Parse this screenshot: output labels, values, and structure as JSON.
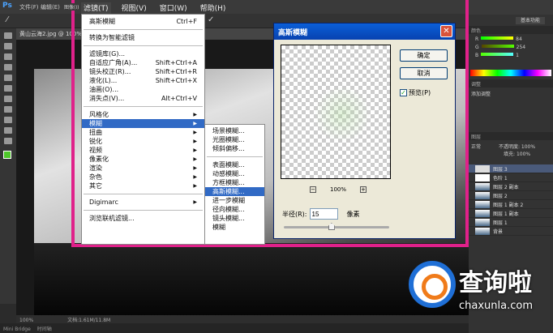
{
  "app": {
    "logo": "Ps",
    "menus": [
      "文件(F)",
      "编辑(E)",
      "图像(I)"
    ],
    "doc_tab": "黄山云海2.jpg @ 100%"
  },
  "menubar": [
    "滤镜(T)",
    "视图(V)",
    "窗口(W)",
    "帮助(H)"
  ],
  "filter_menu": {
    "top": [
      {
        "label": "高斯模糊",
        "shortcut": "Ctrl+F"
      }
    ],
    "convert": "转换为智能滤镜",
    "group1": [
      {
        "label": "滤镜库(G)...",
        "shortcut": ""
      },
      {
        "label": "自适应广角(A)...",
        "shortcut": "Shift+Ctrl+A"
      },
      {
        "label": "镜头校正(R)...",
        "shortcut": "Shift+Ctrl+R"
      },
      {
        "label": "液化(L)...",
        "shortcut": "Shift+Ctrl+X"
      },
      {
        "label": "油画(O)...",
        "shortcut": ""
      },
      {
        "label": "消失点(V)...",
        "shortcut": "Alt+Ctrl+V"
      }
    ],
    "group2": [
      "风格化",
      "模糊",
      "扭曲",
      "锐化",
      "视频",
      "像素化",
      "渲染",
      "杂色",
      "其它"
    ],
    "highlighted": "模糊",
    "digimarc": "Digimarc",
    "browse": "浏览联机滤镜..."
  },
  "blur_submenu": {
    "group1": [
      "场景模糊...",
      "光圈模糊...",
      "倾斜偏移..."
    ],
    "group2": [
      "表面模糊...",
      "动感模糊...",
      "方框模糊...",
      "高斯模糊...",
      "进一步模糊",
      "径向模糊...",
      "镜头模糊...",
      "模糊"
    ],
    "highlighted": "高斯模糊..."
  },
  "dialog": {
    "title": "高斯模糊",
    "ok": "确定",
    "cancel": "取消",
    "preview_label": "预览(P)",
    "preview_checked": true,
    "zoom": "100%",
    "zoom_out": "−",
    "zoom_in": "+",
    "radius_label": "半径(R):",
    "radius_value": "15",
    "unit": "像素",
    "slider_fraction": 0.45
  },
  "right_panel": {
    "workspace": "基本功能",
    "color": {
      "R": "84",
      "G": "254",
      "B": "1"
    },
    "adjust_title": "添加调整",
    "blend": "正常",
    "opacity_label": "不透明度:",
    "opacity": "100%",
    "fill_label": "填充:",
    "fill": "100%",
    "layers": [
      "图层 3",
      "色阶 1",
      "图层 2 副本",
      "图层 2",
      "图层 1 副本 2",
      "图层 1 副本",
      "图层 1",
      "背景"
    ]
  },
  "status": {
    "zoom": "100%",
    "doc": "文档:1.61M/11.8M"
  },
  "bottom_tabs": [
    "Mini Bridge",
    "时间轴"
  ],
  "watermark": {
    "text": "查询啦",
    "url": "chaxunla.com"
  },
  "colors": {
    "frame": "#e0218a",
    "highlight": "#316ac5",
    "foreground": "#4ec62a"
  }
}
